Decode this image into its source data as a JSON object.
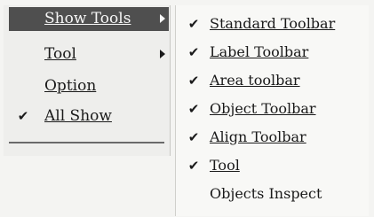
{
  "main_menu": {
    "items": [
      {
        "label": "Show Tools",
        "checked": false,
        "has_submenu": true,
        "active": true
      },
      {
        "label": "Tool",
        "checked": false,
        "has_submenu": true,
        "active": false
      },
      {
        "label": "Option",
        "checked": false,
        "has_submenu": false,
        "active": false
      },
      {
        "label": "All Show",
        "checked": true,
        "has_submenu": false,
        "active": false
      }
    ]
  },
  "submenu": {
    "items": [
      {
        "label": "Standard Toolbar",
        "checked": true
      },
      {
        "label": "Label Toolbar",
        "checked": true
      },
      {
        "label": "Area toolbar",
        "checked": true
      },
      {
        "label": "Object Toolbar",
        "checked": true
      },
      {
        "label": "Align Toolbar",
        "checked": true
      },
      {
        "label": "Tool",
        "checked": true
      },
      {
        "label": "Objects Inspect",
        "checked": false
      }
    ]
  },
  "icons": {
    "check": "checkmark-icon",
    "submenu_arrow": "submenu-arrow-icon"
  },
  "colors": {
    "active_bg": "#4f4f4f",
    "active_text": "#f6f6f6",
    "menu_bg": "#eeeeec",
    "submenu_bg": "#f8f8f6"
  }
}
